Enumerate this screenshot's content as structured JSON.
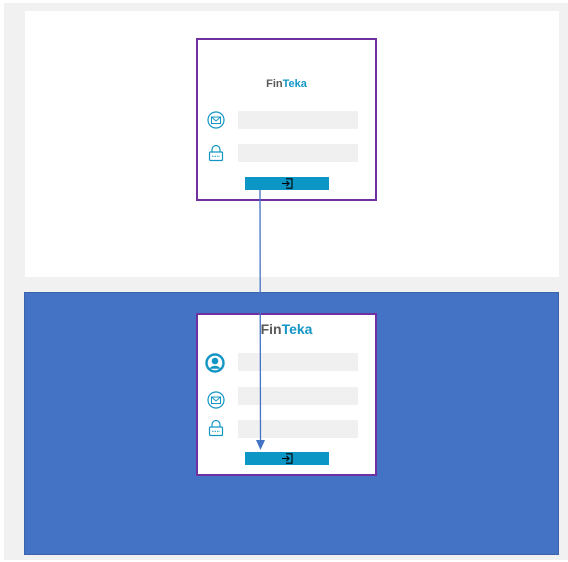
{
  "login_card": {
    "logo": {
      "fin": "Fin",
      "teka": "Teka"
    },
    "fields": [
      {
        "icon": "envelope-icon"
      },
      {
        "icon": "lock-icon"
      }
    ],
    "submit_icon": "sign-in-icon"
  },
  "signup_card": {
    "logo": {
      "fin": "Fin",
      "teka": "Teka"
    },
    "fields": [
      {
        "icon": "user-icon"
      },
      {
        "icon": "envelope-icon"
      },
      {
        "icon": "lock-icon"
      }
    ],
    "submit_icon": "sign-in-icon"
  },
  "colors": {
    "screen_background": "#4472c4",
    "card_border": "#7030a0",
    "brand_accent": "#1496c4",
    "button": "#0b96c6",
    "arrow": "#4472c4"
  }
}
